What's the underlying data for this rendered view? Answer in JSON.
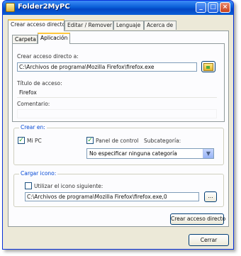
{
  "window": {
    "title": "Folder2MyPC"
  },
  "tabs": [
    {
      "label": "Crear acceso directo"
    },
    {
      "label": "Editar / Remover"
    },
    {
      "label": "Lenguaje"
    },
    {
      "label": "Acerca de"
    }
  ],
  "subtabs": [
    {
      "label": "Carpeta"
    },
    {
      "label": "Aplicación"
    }
  ],
  "application": {
    "shortcut_label": "Crear acceso directo a:",
    "shortcut_path": "C:\\Archivos de programa\\Mozilla Firefox\\firefox.exe",
    "title_label": "Título de acceso:",
    "title_value": "Firefox",
    "comment_label": "Comentario:",
    "comment_value": ""
  },
  "create_in": {
    "title": "Crear en:",
    "mypc_label": "Mi PC",
    "controlpanel_label": "Panel de control",
    "subcategory_label": "Subcategoría:",
    "subcategory_value": "No especificar ninguna categoría"
  },
  "icon_group": {
    "title": "Cargar icono:",
    "use_following_label": "Utilizar el icono siguiente:",
    "icon_path": "C:\\Archivos de programa\\Mozilla Firefox\\firefox.exe,0",
    "browse_label": "..."
  },
  "buttons": {
    "create_shortcut": "Crear acceso directo",
    "close": "Cerrar"
  }
}
